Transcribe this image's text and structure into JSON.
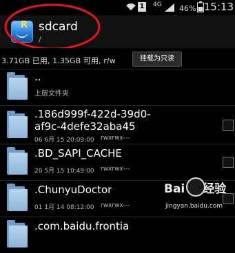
{
  "status_bar": {
    "network": "4G",
    "sim_badge": "1",
    "battery_percent": "46%",
    "time": "15:13"
  },
  "header": {
    "title": "sdcard",
    "path": "/"
  },
  "storage": {
    "info": "3.71GB 已用, 1.35GB 可用, r/w",
    "mount_button": "挂载为只读"
  },
  "files": [
    {
      "name": "..",
      "subtitle": "上层文件夹",
      "date": "",
      "perm": ""
    },
    {
      "name": ".186d999f-422d-39d0-",
      "name_line2": "af9c-4defe32aba45",
      "date": "06 6月 15 20:09:00",
      "perm": "rwxrwx---"
    },
    {
      "name": ".BD_SAPI_CACHE",
      "date": "20 5月 15 10:49:00",
      "perm": "rwxrwx---"
    },
    {
      "name": ".ChunyuDoctor",
      "date": "01 1月 14 08:12:00",
      "perm": "rwxrwx---"
    },
    {
      "name": ".com.baidu.frontia",
      "date": "",
      "perm": ""
    }
  ],
  "watermark": {
    "logo_text": "Bai",
    "logo_text2": "经验",
    "sub": "jingyan.baidu.com"
  },
  "colors": {
    "annotation": "#e8141c",
    "folder": "#8fb5d8"
  }
}
